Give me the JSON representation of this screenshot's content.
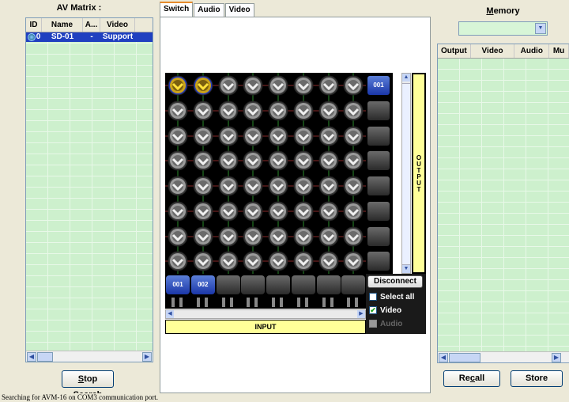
{
  "left_panel": {
    "title": "AV Matrix :",
    "columns": [
      "ID",
      "Name",
      "A...",
      "Video"
    ],
    "rows": [
      {
        "id": "0",
        "name": "SD-01",
        "audio": "-",
        "video": "Support"
      }
    ],
    "stop_button": {
      "prefix": "",
      "underlined": "S",
      "rest": "top Search"
    }
  },
  "tabs": [
    {
      "label": "Switch",
      "active": true
    },
    {
      "label": "Audio",
      "active": false
    },
    {
      "label": "Video",
      "active": false
    }
  ],
  "matrix": {
    "rows": 8,
    "cols": 8,
    "connected": [
      [
        0,
        0
      ],
      [
        0,
        1
      ]
    ],
    "outputs": [
      "001",
      "",
      "",
      "",
      "",
      "",
      "",
      ""
    ],
    "inputs": [
      "001",
      "002",
      "",
      "",
      "",
      "",
      "",
      ""
    ],
    "output_label": "OUTPUT",
    "input_label": "INPUT"
  },
  "controls": {
    "disconnect": "Disconnect",
    "select_all": {
      "label": "Select all",
      "checked": false
    },
    "video": {
      "label": "Video",
      "checked": true
    },
    "audio": {
      "label": "Audio",
      "checked": false,
      "disabled": true
    }
  },
  "right_panel": {
    "title_underlined": "M",
    "title_rest": "emory",
    "combo_value": "",
    "columns": [
      "Output",
      "Video",
      "Audio",
      "Mu"
    ],
    "recall": {
      "pre": "Re",
      "underlined": "c",
      "post": "all"
    },
    "store": "Store"
  },
  "status_bar": "Searching for AVM-16 on COM3 communication port.",
  "colors": {
    "table_bg": "#cdf0cd",
    "selection": "#2040c0",
    "bar_yellow": "#ffff99",
    "active_btn": "#1a36a8"
  }
}
